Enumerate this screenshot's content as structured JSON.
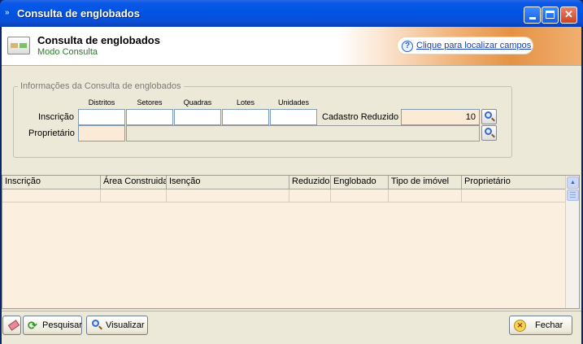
{
  "window": {
    "title": "Consulta de englobados"
  },
  "header": {
    "title": "Consulta de englobados",
    "subtitle": "Modo Consulta",
    "locate_link": "Clique para localizar campos"
  },
  "form": {
    "group_title": "Informações da Consulta de englobados",
    "columns": {
      "distritos": "Distritos",
      "setores": "Setores",
      "quadras": "Quadras",
      "lotes": "Lotes",
      "unidades": "Unidades"
    },
    "inscricao_label": "Inscrição",
    "inscricao_values": {
      "distritos": "",
      "setores": "",
      "quadras": "",
      "lotes": "",
      "unidades": ""
    },
    "cadastro_reduzido_label": "Cadastro Reduzido",
    "cadastro_reduzido_value": "10",
    "proprietario_label": "Proprietário",
    "proprietario_code": "",
    "proprietario_name": ""
  },
  "grid": {
    "columns": [
      "Inscrição",
      "Área Construida",
      "Isenção",
      "Reduzido",
      "Englobado",
      "Tipo de imóvel",
      "Proprietário"
    ],
    "rows": []
  },
  "toolbar": {
    "pesquisar_label": "Pesquisar",
    "visualizar_label": "Visualizar",
    "fechar_label": "Fechar"
  },
  "colors": {
    "titlebar": "#0054e3",
    "window_bg": "#ece9d8",
    "required_field": "#fbead6",
    "subtitle_green": "#2c7a2c",
    "link_blue": "#1740b0"
  },
  "icons": [
    "window-menu-icon",
    "minimize-icon",
    "maximize-icon",
    "close-icon",
    "form-icon",
    "help-icon",
    "search-icon",
    "eraser-icon",
    "refresh-icon",
    "magnifier-icon",
    "exit-icon"
  ]
}
